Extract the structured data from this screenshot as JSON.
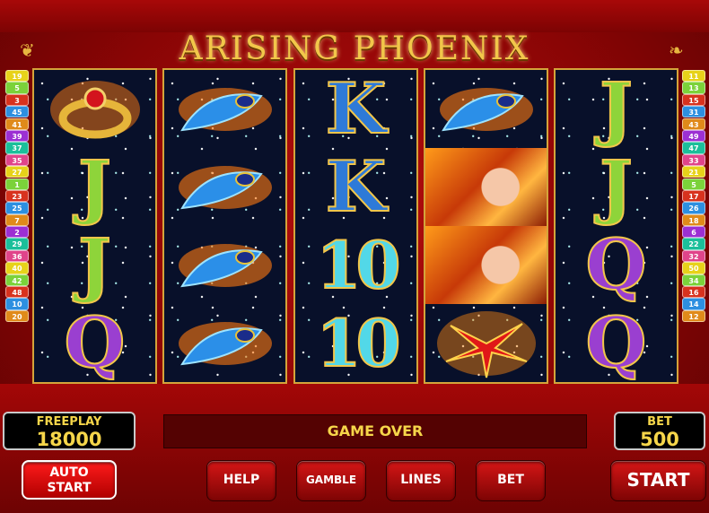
{
  "game": {
    "title": "ARISING PHOENIX",
    "message": "GAME OVER"
  },
  "freeplay": {
    "label": "FREEPLAY",
    "value": "18000"
  },
  "bet": {
    "label": "BET",
    "value": "500"
  },
  "buttons": {
    "auto": "AUTO\nSTART",
    "help": "HELP",
    "gamble": "GAMBLE",
    "lines": "LINES",
    "bet": "BET",
    "start": "START"
  },
  "left_lines": [
    "19",
    "5",
    "3",
    "45",
    "41",
    "39",
    "37",
    "35",
    "27",
    "1",
    "23",
    "25",
    "7",
    "2",
    "29",
    "36",
    "40",
    "42",
    "48",
    "10",
    "20"
  ],
  "right_lines": [
    "11",
    "13",
    "15",
    "31",
    "43",
    "49",
    "47",
    "33",
    "21",
    "5",
    "17",
    "26",
    "18",
    "6",
    "22",
    "32",
    "50",
    "34",
    "16",
    "14",
    "12"
  ],
  "reels": [
    [
      "ring",
      "J",
      "J",
      "Q"
    ],
    [
      "feather",
      "feather",
      "feather",
      "feather"
    ],
    [
      "K",
      "K",
      "10",
      "10"
    ],
    [
      "feather",
      "phoenix-lady",
      "phoenix-lady",
      "red-lily"
    ],
    [
      "J",
      "J",
      "Q",
      "Q"
    ]
  ],
  "colors": {
    "accent": "#f6d64a",
    "frame": "#a80808"
  }
}
